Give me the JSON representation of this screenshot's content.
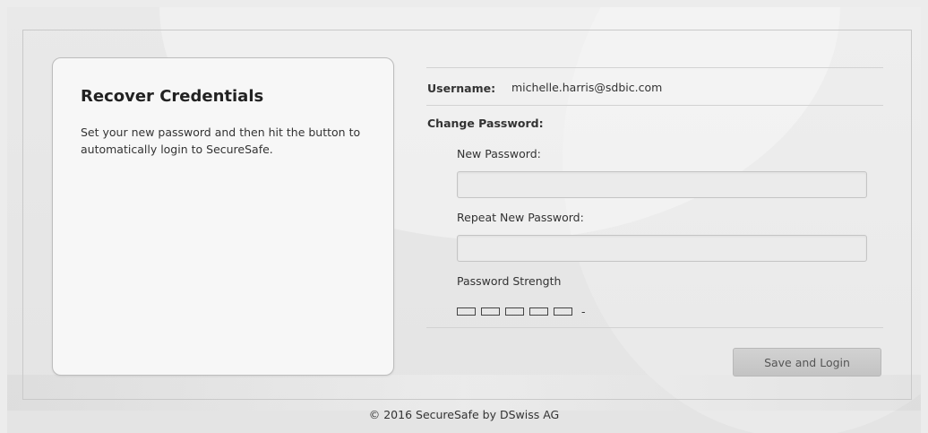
{
  "card": {
    "title": "Recover Credentials",
    "description": "Set your new password and then hit the button to automatically login to SecureSafe."
  },
  "form": {
    "username_label": "Username:",
    "username_value": "michelle.harris@sdbic.com",
    "change_password_label": "Change Password:",
    "new_password_label": "New Password:",
    "new_password_value": "",
    "repeat_password_label": "Repeat New Password:",
    "repeat_password_value": "",
    "strength_label": "Password Strength",
    "strength_text": "-",
    "strength_level": 0,
    "strength_segments": 5
  },
  "actions": {
    "save_label": "Save and Login"
  },
  "footer": {
    "copyright": "© 2016 SecureSafe by DSwiss AG"
  }
}
